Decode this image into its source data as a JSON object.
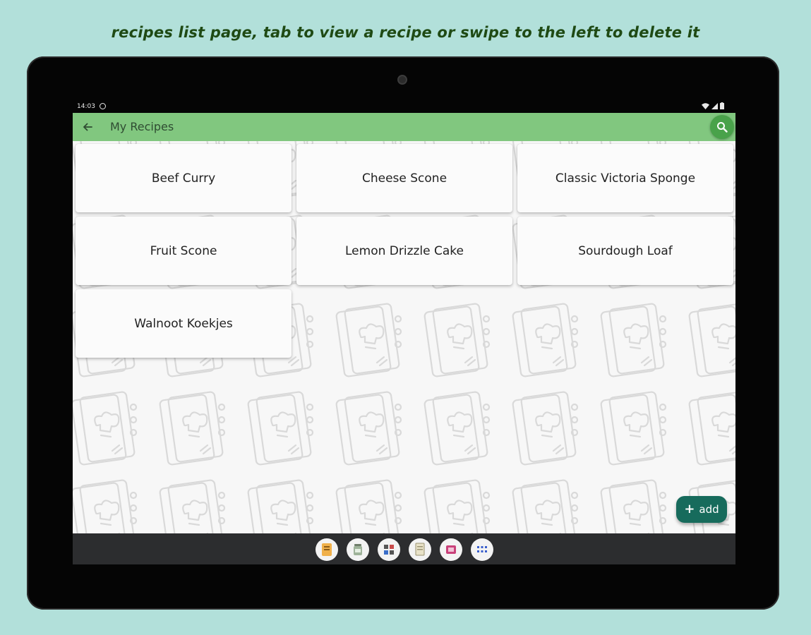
{
  "caption": "recipes list page, tab to view a recipe or swipe to the left to delete it",
  "status_bar": {
    "time": "14:03"
  },
  "app_bar": {
    "title": "My Recipes",
    "back_icon": "arrow-left-icon",
    "search_icon": "search-icon"
  },
  "recipes": [
    {
      "label": "Beef Curry"
    },
    {
      "label": "Cheese Scone"
    },
    {
      "label": "Classic Victoria Sponge"
    },
    {
      "label": "Fruit Scone"
    },
    {
      "label": "Lemon Drizzle Cake"
    },
    {
      "label": "Sourdough Loaf"
    },
    {
      "label": "Walnoot Koekjes"
    }
  ],
  "fab": {
    "label": "add",
    "icon": "plus-icon"
  },
  "dock_apps": [
    "app-icon-1",
    "app-icon-2",
    "app-icon-3",
    "app-icon-4",
    "app-icon-5",
    "app-drawer-icon"
  ],
  "colors": {
    "background": "#b2e0da",
    "app_bar": "#81c77f",
    "search_button": "#49a24a",
    "fab": "#176b5c",
    "caption": "#1f4a14"
  }
}
